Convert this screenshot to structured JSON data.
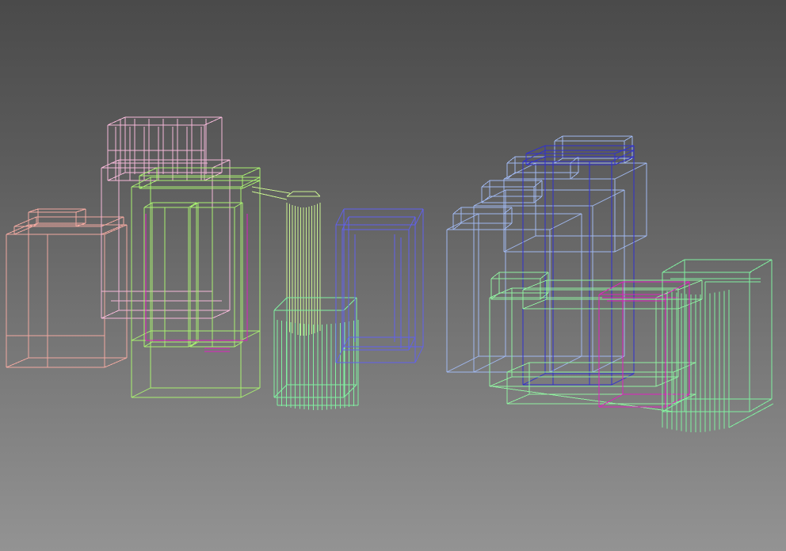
{
  "viewport": {
    "mode": "wireframe",
    "background_top": "#4a4a4a",
    "background_bottom": "#939393"
  },
  "objects": [
    {
      "name": "salmon-cabinet",
      "color": "#f0a8a0"
    },
    {
      "name": "pink-upper-rack",
      "color": "#f4b8d8"
    },
    {
      "name": "green-tall-cabinet",
      "color": "#a8f070"
    },
    {
      "name": "magenta-cabinet-door",
      "color": "#e020c0"
    },
    {
      "name": "green-column",
      "color": "#c8f090"
    },
    {
      "name": "green-round-planter",
      "color": "#80f0a0"
    },
    {
      "name": "blue-door-frame",
      "color": "#6060f0"
    },
    {
      "name": "lightblue-stepped-building",
      "color": "#a0b8f0"
    },
    {
      "name": "blue-tall-tower",
      "color": "#3030d0"
    },
    {
      "name": "green-low-counter",
      "color": "#90f0a0"
    },
    {
      "name": "magenta-small-box",
      "color": "#e020c0"
    },
    {
      "name": "green-rounded-tank",
      "color": "#80f0a0"
    }
  ]
}
